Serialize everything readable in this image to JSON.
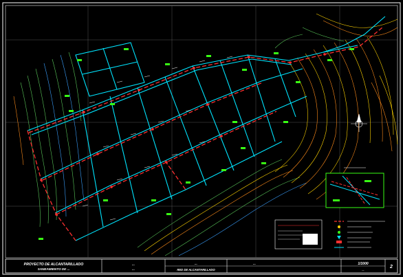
{
  "title_block": {
    "project_line1": "PROYECTO DE ALCANTARILLADO",
    "project_line2": "SANEAMIENTO DE ...",
    "cell2_line1": "...",
    "cell2_line2": "...",
    "sheet_title": "...",
    "drawing_name": "RED DE ALCANTARILLADO",
    "drawn_by": "...",
    "scale_text": "1/1000",
    "date_text": "...",
    "sheet_no": "2"
  },
  "legend": {
    "items": [
      "",
      "",
      "",
      "",
      "",
      ""
    ]
  },
  "colors": {
    "background": "#000000",
    "frame": "#ffffff",
    "network_main": "#ff3030",
    "network_secondary": "#00e5ff",
    "labels": "#ffffff",
    "highlight": "#39ff14",
    "contour_yellow": "#ffd400",
    "contour_orange": "#ff8c1a",
    "contour_green": "#5ac85a",
    "contour_blue": "#3aa0ff"
  }
}
